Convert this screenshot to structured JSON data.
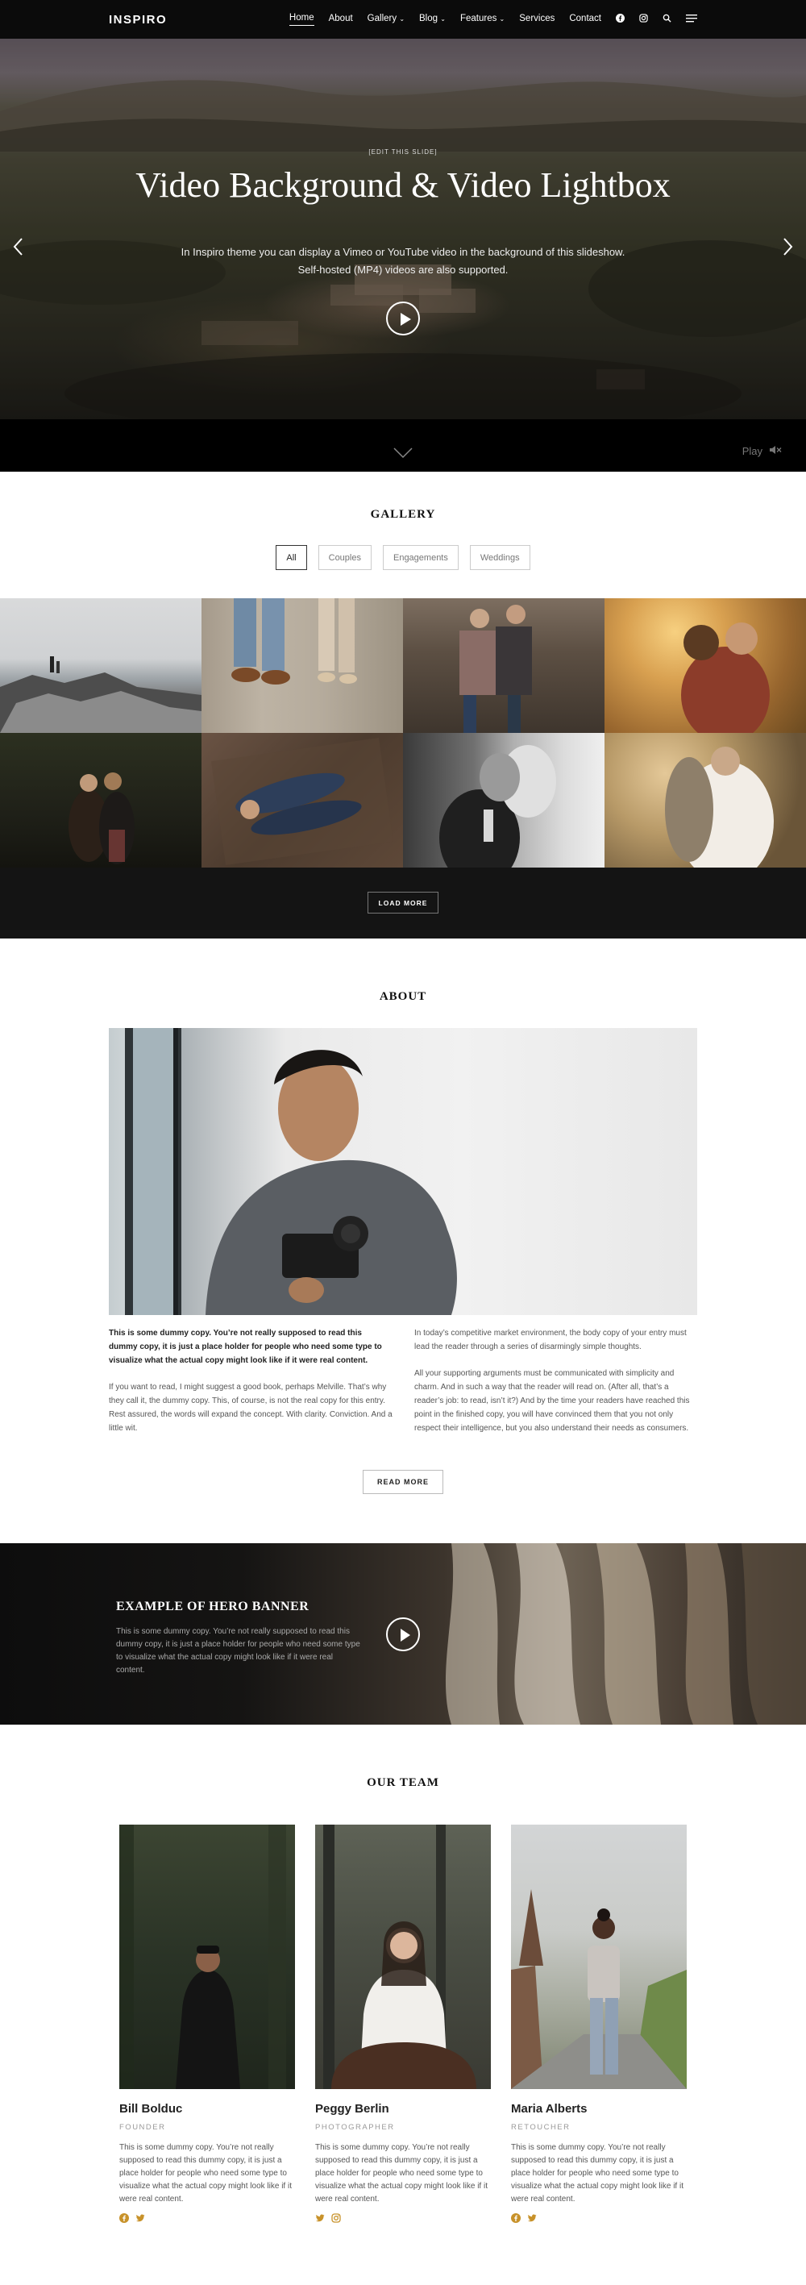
{
  "header": {
    "logo": "INSPIRO",
    "nav": [
      {
        "label": "Home",
        "active": true
      },
      {
        "label": "About"
      },
      {
        "label": "Gallery"
      },
      {
        "label": "Blog"
      },
      {
        "label": "Features"
      },
      {
        "label": "Services"
      },
      {
        "label": "Contact"
      }
    ],
    "icons": [
      "facebook-icon",
      "instagram-icon",
      "search-icon",
      "menu-icon"
    ]
  },
  "hero": {
    "edit_link": "[EDIT THIS SLIDE]",
    "title": "Video Background & Video Lightbox",
    "description": "In Inspiro theme you can display a Vimeo or YouTube video in the background of this slideshow. Self-hosted (MP4) videos are also supported.",
    "play_label": "Play"
  },
  "gallery": {
    "title": "GALLERY",
    "filters": [
      "All",
      "Couples",
      "Engagements",
      "Weddings"
    ],
    "selected_filter": "All",
    "load_more": "LOAD MORE"
  },
  "about": {
    "title": "ABOUT",
    "col1_bold": "This is some dummy copy. You’re not really supposed to read this dummy copy, it is just a place holder for people who need some type to visualize what the actual copy might look like if it were real content.",
    "col1_text": "If you want to read, I might suggest a good book, perhaps Melville. That’s why they call it, the dummy copy. This, of course, is not the real copy for this entry. Rest assured, the words will expand the concept. With clarity. Conviction. And a little wit.",
    "col2_p1": "In today’s competitive market environment, the body copy of your entry must lead the reader through a series of disarmingly simple thoughts.",
    "col2_p2": "All your supporting arguments must be communicated with simplicity and charm. And in such a way that the reader will read on. (After all, that’s a reader’s job: to read, isn’t it?) And by the time your readers have reached this point in the finished copy, you will have convinced them that you not only respect their intelligence, but you also understand their needs as consumers.",
    "read_more": "READ MORE"
  },
  "banner": {
    "title": "EXAMPLE OF HERO BANNER",
    "description": "This is some dummy copy. You’re not really supposed to read this dummy copy, it is just a place holder for people who need some type to visualize what the actual copy might look like if it were real content."
  },
  "team": {
    "title": "OUR TEAM",
    "members": [
      {
        "name": "Bill Bolduc",
        "role": "FOUNDER",
        "desc": "This is some dummy copy. You’re not really supposed to read this dummy copy, it is just a place holder for people who need some type to visualize what the actual copy might look like if it were real content.",
        "social": [
          "facebook-icon",
          "twitter-icon"
        ]
      },
      {
        "name": "Peggy Berlin",
        "role": "PHOTOGRAPHER",
        "desc": "This is some dummy copy. You’re not really supposed to read this dummy copy, it is just a place holder for people who need some type to visualize what the actual copy might look like if it were real content.",
        "social": [
          "twitter-icon",
          "instagram-icon"
        ]
      },
      {
        "name": "Maria Alberts",
        "role": "RETOUCHER",
        "desc": "This is some dummy copy. You’re not really supposed to read this dummy copy, it is just a place holder for people who need some type to visualize what the actual copy might look like if it were real content.",
        "social": [
          "facebook-icon",
          "twitter-icon"
        ]
      }
    ]
  },
  "colors": {
    "accent": "#c8922a",
    "header_bg": "#0b0b0b",
    "band_bg": "#141414"
  }
}
